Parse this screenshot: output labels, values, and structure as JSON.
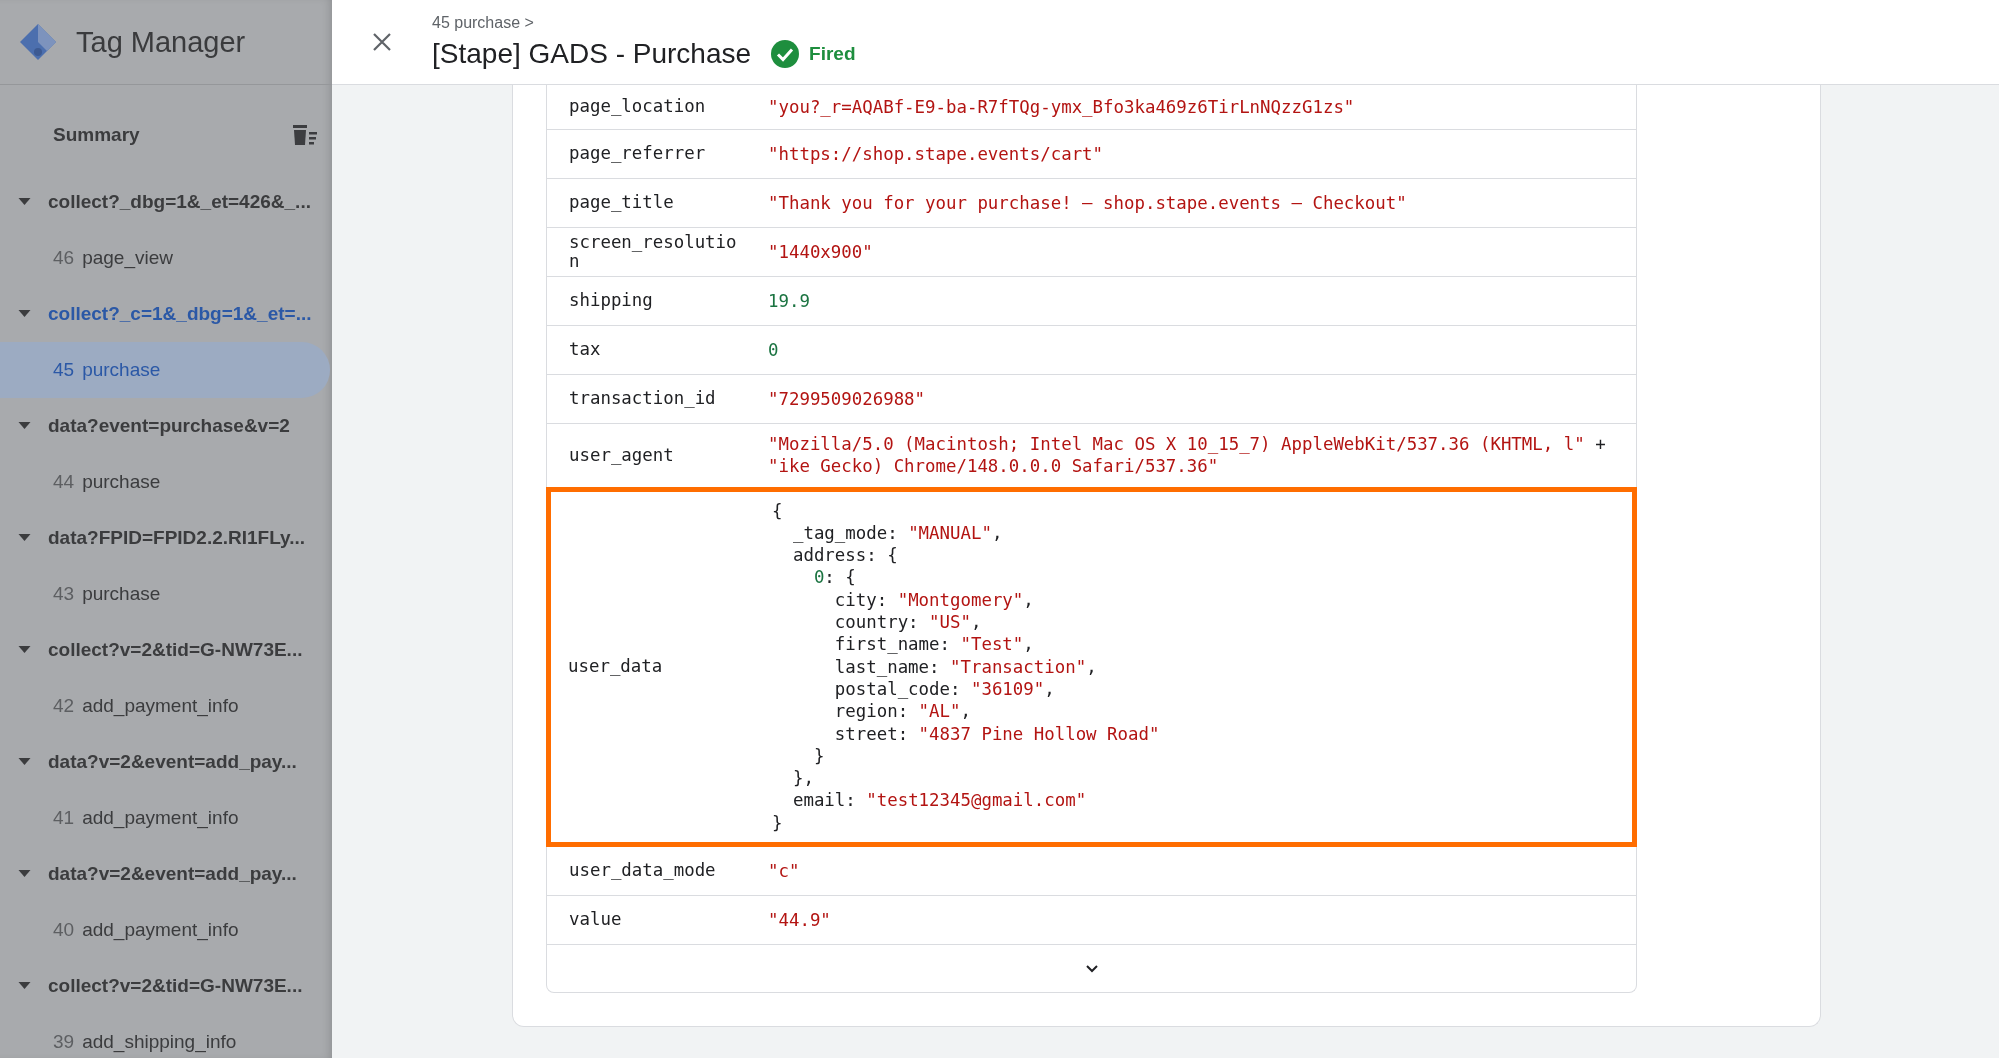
{
  "app": {
    "title": "Tag Manager"
  },
  "sidebar": {
    "summary": "Summary",
    "groups": [
      {
        "label": "collect?_dbg=1&_et=426&_...",
        "expanded": true,
        "selected": false,
        "children": [
          {
            "number": "46",
            "label": "page_view",
            "selected": false
          }
        ]
      },
      {
        "label": "collect?_c=1&_dbg=1&_et=...",
        "expanded": true,
        "selected": true,
        "children": [
          {
            "number": "45",
            "label": "purchase",
            "selected": true
          }
        ]
      },
      {
        "label": "data?event=purchase&v=2",
        "expanded": true,
        "selected": false,
        "children": [
          {
            "number": "44",
            "label": "purchase",
            "selected": false
          }
        ]
      },
      {
        "label": "data?FPID=FPID2.2.RI1FLy...",
        "expanded": true,
        "selected": false,
        "children": [
          {
            "number": "43",
            "label": "purchase",
            "selected": false
          }
        ]
      },
      {
        "label": "collect?v=2&tid=G-NW73E...",
        "expanded": true,
        "selected": false,
        "children": [
          {
            "number": "42",
            "label": "add_payment_info",
            "selected": false
          }
        ]
      },
      {
        "label": "data?v=2&event=add_pay...",
        "expanded": true,
        "selected": false,
        "children": [
          {
            "number": "41",
            "label": "add_payment_info",
            "selected": false
          }
        ]
      },
      {
        "label": "data?v=2&event=add_pay...",
        "expanded": true,
        "selected": false,
        "children": [
          {
            "number": "40",
            "label": "add_payment_info",
            "selected": false
          }
        ]
      },
      {
        "label": "collect?v=2&tid=G-NW73E...",
        "expanded": true,
        "selected": false,
        "children": [
          {
            "number": "39",
            "label": "add_shipping_info",
            "selected": false
          }
        ]
      }
    ]
  },
  "header": {
    "breadcrumb": "45 purchase >",
    "title": "[Stape] GADS - Purchase",
    "status": "Fired"
  },
  "table": {
    "rows": [
      {
        "kind": "plain",
        "name": "page_location",
        "lines": [
          {
            "text": "\"you?_r=AQABf-E9-ba-R7fTQg-ymx_Bfo3ka469z6TirLnNQzzG1zs\"",
            "kind": "string"
          }
        ]
      },
      {
        "kind": "plain",
        "name": "page_referrer",
        "lines": [
          {
            "text": "\"https://shop.stape.events/cart\"",
            "kind": "string"
          }
        ]
      },
      {
        "kind": "plain",
        "name": "page_title",
        "lines": [
          {
            "text": "\"Thank you for your purchase! – shop.stape.events – Checkout\"",
            "kind": "string"
          }
        ]
      },
      {
        "kind": "plain",
        "name": "screen_resolution",
        "lines": [
          {
            "text": "\"1440x900\"",
            "kind": "string"
          }
        ]
      },
      {
        "kind": "plain",
        "name": "shipping",
        "lines": [
          {
            "text": "19.9",
            "kind": "number"
          }
        ]
      },
      {
        "kind": "plain",
        "name": "tax",
        "lines": [
          {
            "text": "0",
            "kind": "number"
          }
        ]
      },
      {
        "kind": "plain",
        "name": "transaction_id",
        "lines": [
          {
            "text": "\"7299509026988\"",
            "kind": "string"
          }
        ]
      },
      {
        "kind": "plain",
        "name": "user_agent",
        "lines": [
          {
            "text": "\"Mozilla/5.0 (Macintosh; Intel Mac OS X 10_15_7) AppleWebKit/537.36 (KHTML, l\"",
            "kind": "string",
            "tail": " +"
          },
          {
            "text": "\"ike Gecko) Chrome/148.0.0.0 Safari/537.36\"",
            "kind": "string"
          }
        ]
      },
      {
        "kind": "object",
        "name": "user_data",
        "highlighted": true,
        "open": "{",
        "close": "}",
        "entries": [
          {
            "key": "_tag_mode:",
            "kind": "name",
            "value": "\"MANUAL\"",
            "tail": ","
          },
          {
            "key": "address:",
            "kind": "name",
            "open": "{",
            "close": "},",
            "children": [
              {
                "key": "0",
                "sep": ":",
                "kind": "number",
                "open": "{",
                "close": "}",
                "children": [
                  {
                    "key": "city:",
                    "kind": "name",
                    "value": "\"Montgomery\"",
                    "tail": ","
                  },
                  {
                    "key": "country:",
                    "kind": "name",
                    "value": "\"US\"",
                    "tail": ","
                  },
                  {
                    "key": "first_name:",
                    "kind": "name",
                    "value": "\"Test\"",
                    "tail": ","
                  },
                  {
                    "key": "last_name:",
                    "kind": "name",
                    "value": "\"Transaction\"",
                    "tail": ","
                  },
                  {
                    "key": "postal_code:",
                    "kind": "name",
                    "value": "\"36109\"",
                    "tail": ","
                  },
                  {
                    "key": "region:",
                    "kind": "name",
                    "value": "\"AL\"",
                    "tail": ","
                  },
                  {
                    "key": "street:",
                    "kind": "name",
                    "value": "\"4837 Pine Hollow Road\""
                  }
                ]
              }
            ]
          },
          {
            "key": "email:",
            "kind": "name",
            "value": "\"test12345@gmail.com\""
          }
        ]
      },
      {
        "kind": "plain",
        "name": "user_data_mode",
        "lines": [
          {
            "text": "\"c\"",
            "kind": "string"
          }
        ]
      },
      {
        "kind": "plain",
        "name": "value",
        "lines": [
          {
            "text": "\"44.9\"",
            "kind": "string"
          }
        ]
      }
    ],
    "expand": true
  }
}
